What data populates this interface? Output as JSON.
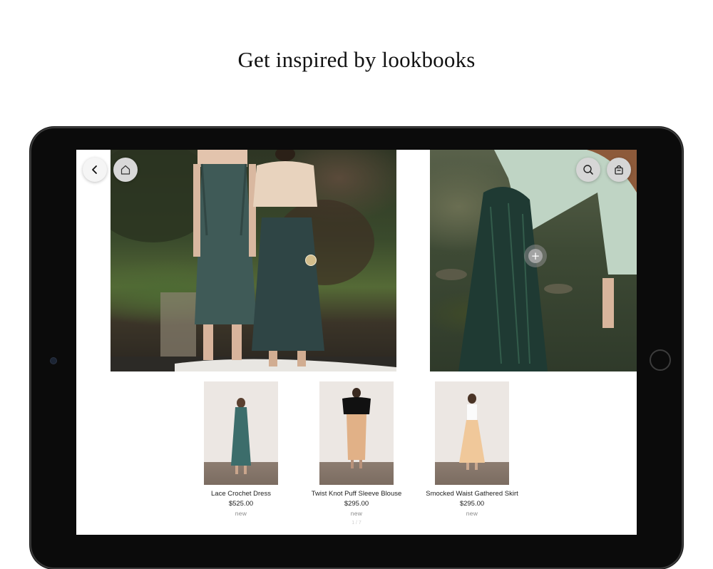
{
  "headline": "Get inspired by lookbooks",
  "nav": {
    "back_icon": "chevron-left-icon",
    "home_icon": "home-icon",
    "search_icon": "search-icon",
    "bag_icon": "shopping-bag-icon"
  },
  "hotspots": {
    "left_dot_color": "#d2bd8c",
    "right_plus": "+"
  },
  "products": [
    {
      "name": "Lace Crochet Dress",
      "price": "$525.00",
      "badge": "new"
    },
    {
      "name": "Twist Knot Puff Sleeve Blouse",
      "price": "$295.00",
      "badge": "new"
    },
    {
      "name": "Smocked Waist Gathered Skirt",
      "price": "$295.00",
      "badge": "new"
    }
  ],
  "pager": "1 / 7"
}
